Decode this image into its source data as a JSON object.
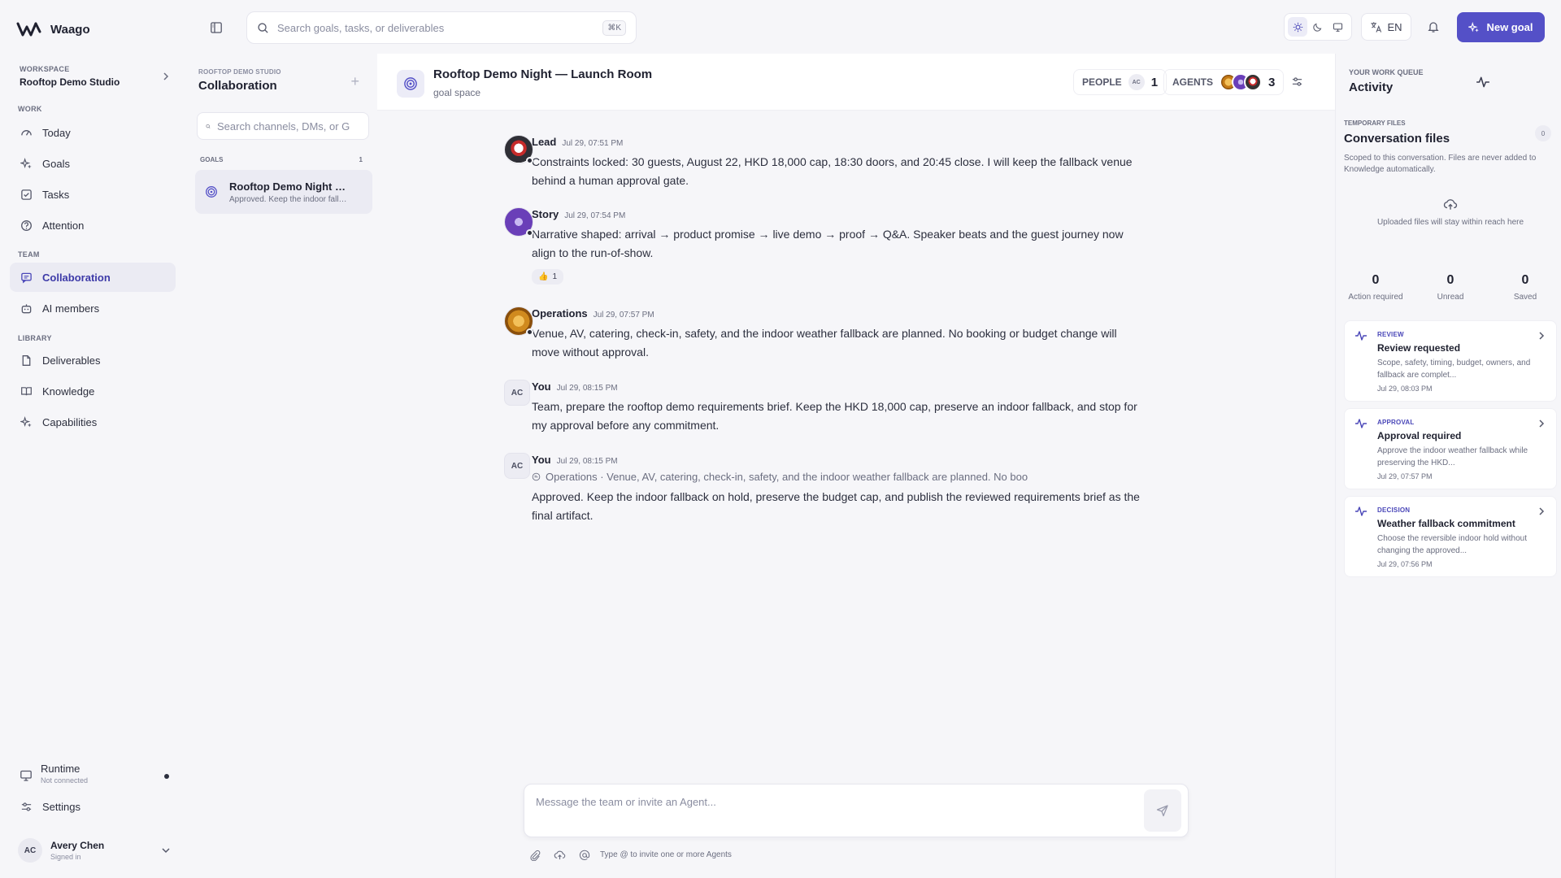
{
  "brand": {
    "name": "Waago"
  },
  "workspace": {
    "label": "WORKSPACE",
    "name": "Rooftop Demo Studio"
  },
  "nav": {
    "work_label": "WORK",
    "team_label": "TEAM",
    "library_label": "LIBRARY",
    "items": [
      {
        "label": "Today",
        "icon": "gauge-icon"
      },
      {
        "label": "Goals",
        "icon": "sparkle-icon"
      },
      {
        "label": "Tasks",
        "icon": "checkbox-icon"
      },
      {
        "label": "Attention",
        "icon": "help-circle-icon"
      },
      {
        "label": "Collaboration",
        "icon": "chat-icon"
      },
      {
        "label": "AI members",
        "icon": "bot-icon"
      },
      {
        "label": "Deliverables",
        "icon": "file-icon"
      },
      {
        "label": "Knowledge",
        "icon": "book-icon"
      },
      {
        "label": "Capabilities",
        "icon": "sparkle-icon"
      }
    ],
    "runtime": {
      "label": "Runtime",
      "status": "Not connected"
    },
    "settings": "Settings",
    "user": {
      "initials": "AC",
      "name": "Avery Chen",
      "status": "Signed in"
    }
  },
  "topbar": {
    "search_placeholder": "Search goals, tasks, or deliverables",
    "shortcut": "⌘K",
    "language": "EN",
    "new_goal": "New goal",
    "accent": "#5450c7"
  },
  "channels": {
    "org": "ROOFTOP DEMO STUDIO",
    "title": "Collaboration",
    "search_placeholder": "Search channels, DMs, or G",
    "goals_label": "GOALS",
    "goals_count": "1",
    "goal": {
      "title": "Rooftop Demo Night — Launch Room",
      "snippet": "Approved. Keep the indoor fallback on hold"
    }
  },
  "room": {
    "title": "Rooftop Demo Night — Launch Room",
    "subtitle": "goal space",
    "people_label": "PEOPLE",
    "people_avatar": "AC",
    "people_count": "1",
    "agents_label": "AGENTS",
    "agents_count": "3"
  },
  "messages": [
    {
      "who": "Lead",
      "time": "Jul 29, 07:51 PM",
      "body": "Constraints locked: 30 guests, August 22, HKD 18,000 cap, 18:30 doors, and 20:45 close. I will keep the fallback venue behind a human approval gate."
    },
    {
      "who": "Story",
      "time": "Jul 29, 07:54 PM",
      "body": "Narrative shaped: arrival → product promise → live demo → proof → Q&A. Speaker beats and the guest journey now align to the run-of-show.",
      "reaction": {
        "emoji": "👍",
        "count": "1"
      }
    },
    {
      "who": "Operations",
      "time": "Jul 29, 07:57 PM",
      "body": "Venue, AV, catering, check-in, safety, and the indoor weather fallback are planned. No booking or budget change will move without approval."
    },
    {
      "who": "You",
      "initials": "AC",
      "time": "Jul 29, 08:15 PM",
      "body": "Team, prepare the rooftop demo requirements brief. Keep the HKD 18,000 cap, preserve an indoor fallback, and stop for my approval before any commitment."
    },
    {
      "who": "You",
      "initials": "AC",
      "time": "Jul 29, 08:15 PM",
      "quote": "Operations · Venue, AV, catering, check-in, safety, and the indoor weather fallback are planned. No boo",
      "body": "Approved. Keep the indoor fallback on hold, preserve the budget cap, and publish the reviewed requirements brief as the final artifact."
    }
  ],
  "composer": {
    "placeholder": "Message the team or invite an Agent...",
    "hint": "Type @ to invite one or more Agents"
  },
  "queue": {
    "label": "YOUR WORK QUEUE",
    "title": "Activity",
    "files_label": "TEMPORARY FILES",
    "files_title": "Conversation files",
    "files_count": "0",
    "files_desc": "Scoped to this conversation. Files are never added to Knowledge automatically.",
    "upload_text": "Uploaded files will stay within reach here",
    "stats": [
      {
        "value": "0",
        "label": "Action required"
      },
      {
        "value": "0",
        "label": "Unread"
      },
      {
        "value": "0",
        "label": "Saved"
      }
    ],
    "cards": [
      {
        "kind": "REVIEW",
        "title": "Review requested",
        "desc": "Scope, safety, timing, budget, owners, and fallback are complet...",
        "time": "Jul 29, 08:03 PM"
      },
      {
        "kind": "APPROVAL",
        "title": "Approval required",
        "desc": "Approve the indoor weather fallback while preserving the HKD...",
        "time": "Jul 29, 07:57 PM"
      },
      {
        "kind": "DECISION",
        "title": "Weather fallback commitment",
        "desc": "Choose the reversible indoor hold without changing the approved...",
        "time": "Jul 29, 07:56 PM"
      }
    ]
  }
}
